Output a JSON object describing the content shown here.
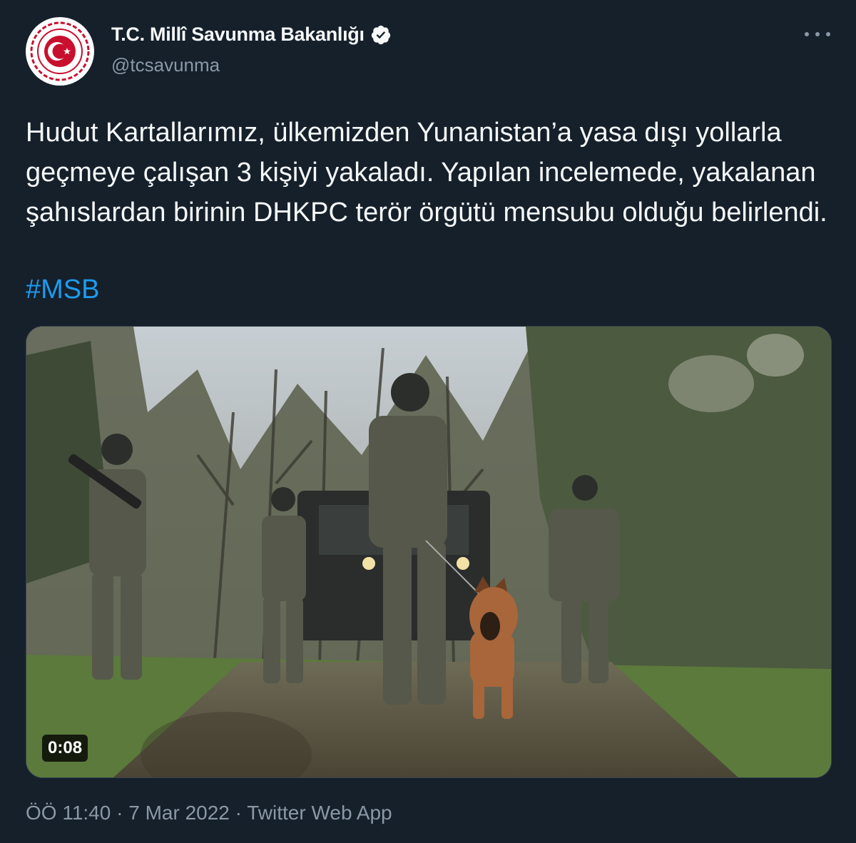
{
  "account": {
    "display_name": "T.C. Millî Savunma Bakanlığı",
    "handle": "@tcsavunma",
    "verified_icon": "verified-badge-icon",
    "more_icon": "more-options-icon"
  },
  "tweet": {
    "text": "Hudut Kartallarımız, ülkemizden Yunanistan’a yasa dışı yollarla geçmeye çalışan 3 kişiyi yakaladı. Yapılan incelemede, yakalanan şahıslardan birinin DHKPC terör örgütü mensubu olduğu belirlendi.",
    "hashtag": "#MSB"
  },
  "media": {
    "type": "video",
    "duration": "0:08"
  },
  "meta": {
    "time": "ÖÖ 11:40",
    "date": "7 Mar 2022",
    "source": "Twitter Web App",
    "separator": "·"
  },
  "colors": {
    "background": "#15202b",
    "text_primary": "#f7f9f9",
    "text_secondary": "#8b98a5",
    "link": "#1d9bf0",
    "logo_red": "#c8102e"
  }
}
